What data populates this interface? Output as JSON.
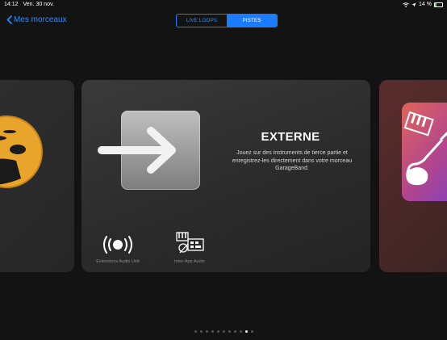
{
  "status_bar": {
    "time": "14:12",
    "date": "Ven. 30 nov.",
    "battery": "14 %"
  },
  "nav": {
    "back_label": "Mes morceaux"
  },
  "segmented": {
    "live_loops": "LIVE LOOPS",
    "pistes": "PISTES",
    "selected": "PISTES"
  },
  "main_card": {
    "title": "EXTERNE",
    "description": "Jouez sur des instruments de tierce partie et enregistrez-les directement dans votre morceau GarageBand.",
    "extensions": [
      {
        "label": "Extensions Audio Unit",
        "icon": "audio-unit-icon"
      },
      {
        "label": "Inter-App Audio",
        "icon": "inter-app-audio-icon"
      }
    ]
  },
  "pager": {
    "count": 11,
    "active_index": 9
  },
  "colors": {
    "accent": "#1b7cff",
    "background": "#131313"
  }
}
